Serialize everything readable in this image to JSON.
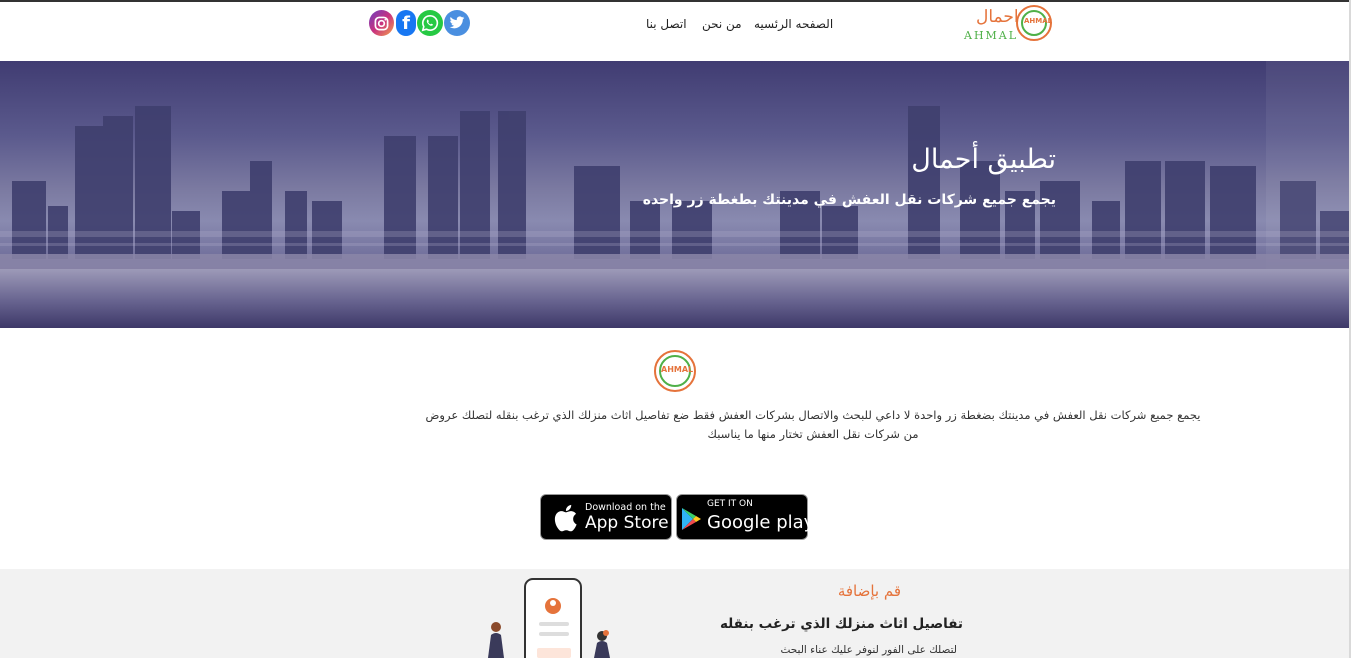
{
  "brand": {
    "name_ar": "احمال",
    "name_en": "AHMAL",
    "badge_text": "AHMAL",
    "colors": {
      "orange": "#e5733b",
      "green": "#4fb048"
    }
  },
  "nav": {
    "home": "الصفحه الرئسيه",
    "about": "من نحن",
    "contact": "اتصل بنا"
  },
  "social": {
    "icons": [
      "instagram-icon",
      "facebook-icon",
      "whatsapp-icon",
      "twitter-icon"
    ],
    "facebook_glyph": "f"
  },
  "hero": {
    "title": "تطبيق أحمال",
    "subtitle": "يجمع جميع شركات نقل العفش في مدينتك بطغطة زر واحده"
  },
  "about": {
    "logo_text": "AHMAL",
    "text": "يجمع جميع شركات نقل العفش في مدينتك بضغطة زر واحدة لا داعي للبحث والاتصال بشركات العفش فقط ضع تفاصيل اثاث منزلك الذي ترغب بنقله لتصلك عروض من شركات نقل العفش تختار منها ما يناسبك"
  },
  "stores": {
    "apple_small": "Download on the",
    "apple_big": "App Store",
    "google_small": "GET IT ON",
    "google_big": "Google play"
  },
  "feature": {
    "heading": "قم بإضافة",
    "title": "تفاصيل اثاث منزلك الذي ترغب بنقله",
    "desc": "لتصلك على الفور لنوفر عليك عناء البحث"
  }
}
